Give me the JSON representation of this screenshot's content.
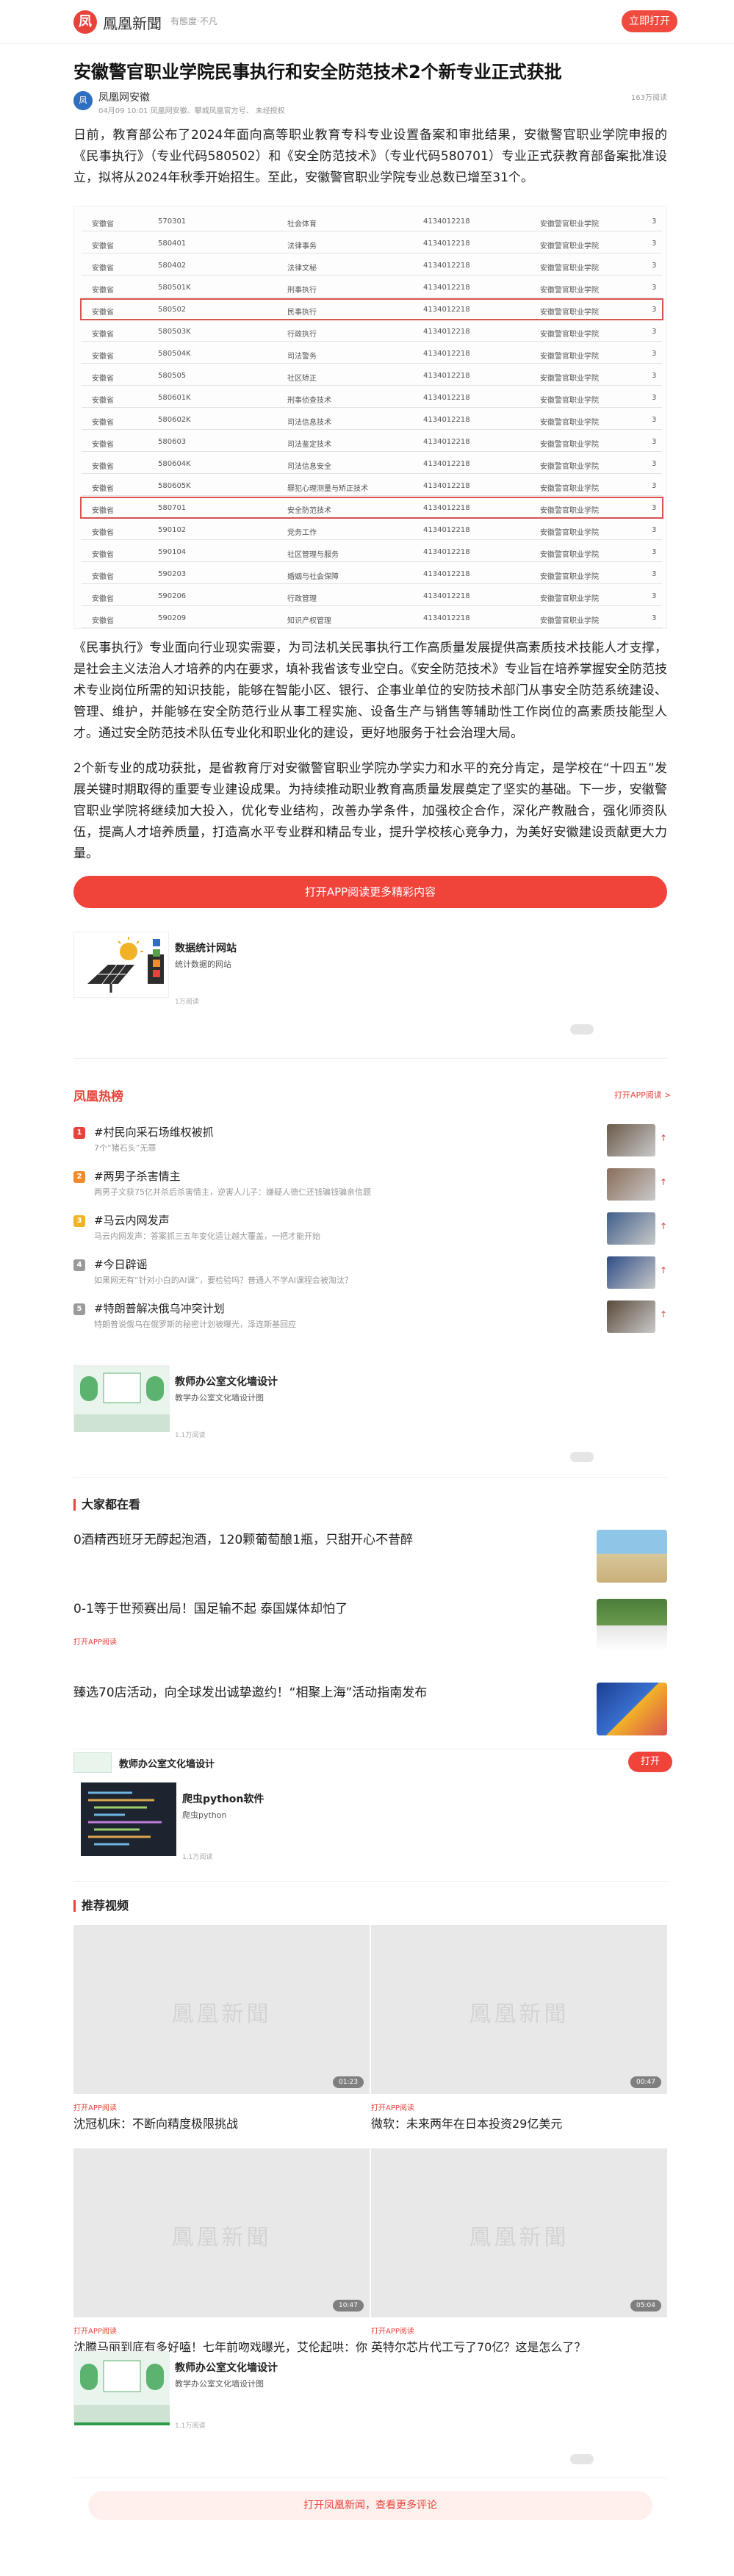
{
  "header": {
    "logo_char": "凤",
    "logo_name": "鳳凰新聞",
    "slogan": "有態度·不凡",
    "open_button": "立即打开"
  },
  "article": {
    "title": "安徽警官职业学院民事执行和安全防范技术2个新专业正式获批",
    "author": "凤凰网安徽",
    "author_avatar": "凤",
    "meta": "04月09 10:01   凤凰网安徽、攀城凤凰官方号、 未经授权",
    "read_count": "163万阅读",
    "para1": "日前，教育部公布了2024年面向高等职业教育专科专业设置备案和审批结果，安徽警官职业学院申报的《民事执行》（专业代码580502）和《安全防范技术》（专业代码580701）专业正式获教育部备案批准设立，拟将从2024年秋季开始招生。至此，安徽警官职业学院专业总数已增至31个。",
    "para2": "《民事执行》专业面向行业现实需要，为司法机关民事执行工作高质量发展提供高素质技术技能人才支撑，是社会主义法治人才培养的内在要求，填补我省该专业空白。《安全防范技术》专业旨在培养掌握安全防范技术专业岗位所需的知识技能，能够在智能小区、银行、企事业单位的安防技术部门从事安全防范系统建设、管理、维护，并能够在安全防范行业从事工程实施、设备生产与销售等辅助性工作岗位的高素质技能型人才。通过安全防范技术队伍专业化和职业化的建设，更好地服务于社会治理大局。",
    "para3": "2个新专业的成功获批，是省教育厅对安徽警官职业学院办学实力和水平的充分肯定，是学校在“十四五”发展关键时期取得的重要专业建设成果。为持续推动职业教育高质量发展奠定了坚实的基础。下一步，安徽警官职业学院将继续加大投入，优化专业结构，改善办学条件，加强校企合作，深化产教融合，强化师资队伍，提高人才培养质量，打造高水平专业群和精品专业，提升学校核心竞争力，为美好安徽建设贡献更大力量。",
    "app_button": "打开APP阅读更多精彩内容"
  },
  "table_rows": [
    [
      "安徽省",
      "570301",
      "社会体育",
      "4134012218",
      "安徽警官职业学院",
      "3"
    ],
    [
      "安徽省",
      "580401",
      "法律事务",
      "4134012218",
      "安徽警官职业学院",
      "3"
    ],
    [
      "安徽省",
      "580402",
      "法律文秘",
      "4134012218",
      "安徽警官职业学院",
      "3"
    ],
    [
      "安徽省",
      "580501K",
      "刑事执行",
      "4134012218",
      "安徽警官职业学院",
      "3"
    ],
    [
      "安徽省",
      "580502",
      "民事执行",
      "4134012218",
      "安徽警官职业学院",
      "3"
    ],
    [
      "安徽省",
      "580503K",
      "行政执行",
      "4134012218",
      "安徽警官职业学院",
      "3"
    ],
    [
      "安徽省",
      "580504K",
      "司法警务",
      "4134012218",
      "安徽警官职业学院",
      "3"
    ],
    [
      "安徽省",
      "580505",
      "社区矫正",
      "4134012218",
      "安徽警官职业学院",
      "3"
    ],
    [
      "安徽省",
      "580601K",
      "刑事侦查技术",
      "4134012218",
      "安徽警官职业学院",
      "3"
    ],
    [
      "安徽省",
      "580602K",
      "司法信息技术",
      "4134012218",
      "安徽警官职业学院",
      "3"
    ],
    [
      "安徽省",
      "580603",
      "司法鉴定技术",
      "4134012218",
      "安徽警官职业学院",
      "3"
    ],
    [
      "安徽省",
      "580604K",
      "司法信息安全",
      "4134012218",
      "安徽警官职业学院",
      "3"
    ],
    [
      "安徽省",
      "580605K",
      "罪犯心理测量与矫正技术",
      "4134012218",
      "安徽警官职业学院",
      "3"
    ],
    [
      "安徽省",
      "580701",
      "安全防范技术",
      "4134012218",
      "安徽警官职业学院",
      "3"
    ],
    [
      "安徽省",
      "590102",
      "党务工作",
      "4134012218",
      "安徽警官职业学院",
      "3"
    ],
    [
      "安徽省",
      "590104",
      "社区管理与服务",
      "4134012218",
      "安徽警官职业学院",
      "3"
    ],
    [
      "安徽省",
      "590203",
      "婚姻与社会保障",
      "4134012218",
      "安徽警官职业学院",
      "3"
    ],
    [
      "安徽省",
      "590206",
      "行政管理",
      "4134012218",
      "安徽警官职业学院",
      "3"
    ],
    [
      "安徽省",
      "590209",
      "知识产权管理",
      "4134012218",
      "安徽警官职业学院",
      "3"
    ]
  ],
  "ad_card_1": {
    "title": "数据统计网站",
    "subtitle": "统计数据的网站",
    "meta": "1万阅读"
  },
  "hot": {
    "title": "凤凰热榜",
    "link": "打开APP阅读 >",
    "items": [
      {
        "rank": "1",
        "title": "#村民向采石场维权被抓",
        "sub": "7个“猪石头”无罪",
        "color": "#e8433b"
      },
      {
        "rank": "2",
        "title": "#两男子杀害情主",
        "sub": "两男子文获75亿并杀后杀害情主，逆害人儿子：嫌疑人德仁还钱骗钱骗亲信题",
        "color": "#f28b2a"
      },
      {
        "rank": "3",
        "title": "#马云内网发声",
        "sub": "马云内网发声：答案抓三五年变化适让越大覆盖，一把才能开始",
        "color": "#f2b227"
      },
      {
        "rank": "4",
        "title": "#今日辟谣",
        "sub": "如果网无有“针对小白的AI课”，要检验吗？普通人不学AI课程会被淘汰？",
        "color": "#9a9a9a"
      },
      {
        "rank": "5",
        "title": "#特朗普解决俄乌冲突计划",
        "sub": "特朗普说俄乌在俄罗斯的秘密计划被曝光，泽连斯基回应",
        "color": "#9a9a9a"
      }
    ]
  },
  "ad_card_2": {
    "title": "教师办公室文化墙设计",
    "subtitle": "教学办公室文化墙设计图",
    "meta": "1.1万阅读"
  },
  "everyone": {
    "title": "大家都在看",
    "items": [
      {
        "title": "0酒精西班牙无醇起泡酒，120颗葡萄酿1瓶，只甜开心不昔醉",
        "src": ""
      },
      {
        "title": "0-1等于世预赛出局！国足输不起 泰国媒体却怕了",
        "src": "打开APP阅读"
      },
      {
        "title": "臻选70店活动，向全球发出诚挚邀约！“相聚上海”活动指南发布",
        "src": ""
      }
    ]
  },
  "float_bar": {
    "title": "教师办公室文化墙设计",
    "open": "打开"
  },
  "ad_card_3": {
    "title": "爬虫python软件",
    "subtitle": "爬虫python",
    "meta": "1.1万阅读"
  },
  "videos": {
    "title": "推荐视频",
    "watermark": "鳳凰新聞",
    "items": [
      {
        "title": "沈冠机床：不断向精度极限挑战",
        "src": "打开APP阅读",
        "duration": "01:23"
      },
      {
        "title": "微软：未来两年在日本投资29亿美元",
        "src": "打开APP阅读",
        "duration": "00:47"
      },
      {
        "title": "沈腾马丽到底有多好嗑！七年前吻戏曝光，艾伦起哄：你伸舌头了吧",
        "src": "打开APP阅读",
        "duration": "10:47"
      },
      {
        "title": "英特尔芯片代工亏了70亿？这是怎么了？",
        "src": "打开APP阅读",
        "duration": "05:04"
      }
    ]
  },
  "ad_card_4": {
    "title": "教师办公室文化墙设计",
    "subtitle": "教学办公室文化墙设计图",
    "meta": "1.1万阅读"
  },
  "bottom_button": "打开凤凰新闻，查看更多评论"
}
